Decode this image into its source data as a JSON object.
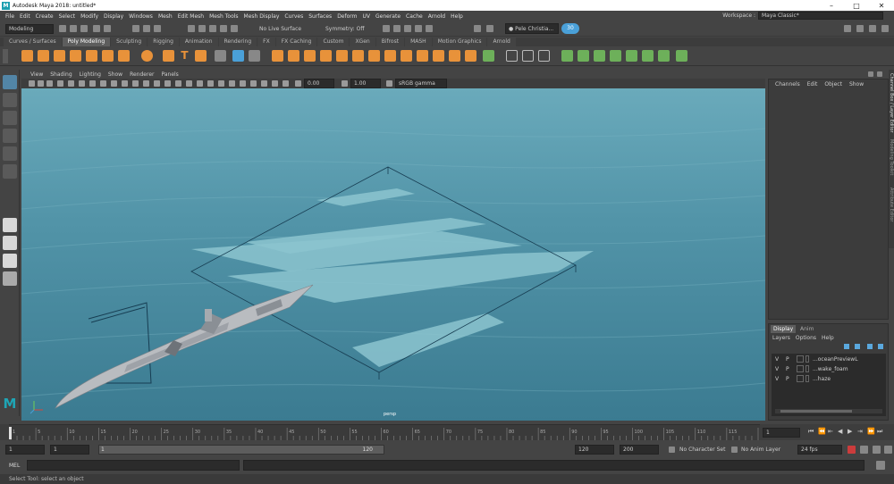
{
  "window": {
    "title": "Autodesk Maya 2018: untitled*",
    "app_icon_letter": "M",
    "controls": [
      "minimize-icon",
      "maximize-icon",
      "close-icon"
    ]
  },
  "menubar": {
    "items": [
      "File",
      "Edit",
      "Create",
      "Select",
      "Modify",
      "Display",
      "Windows",
      "Mesh",
      "Edit Mesh",
      "Mesh Tools",
      "Mesh Display",
      "Curves",
      "Surfaces",
      "Deform",
      "UV",
      "Generate",
      "Cache",
      "Arnold",
      "Help"
    ],
    "workspace_label": "Workspace :",
    "workspace_value": "Maya Classic*"
  },
  "statusline": {
    "menuset": "Modeling",
    "live_surface": "No Live Surface",
    "symmetry": "Symmetry: Off",
    "user": "Pele Christia...",
    "notification_count": "30"
  },
  "shelf": {
    "tabs": [
      "Curves / Surfaces",
      "Poly Modeling",
      "Sculpting",
      "Rigging",
      "Animation",
      "Rendering",
      "FX",
      "FX Caching",
      "Custom",
      "XGen",
      "Bifrost",
      "MASH",
      "Motion Graphics",
      "Arnold"
    ],
    "active_tab": 1
  },
  "panel": {
    "menu": [
      "View",
      "Shading",
      "Lighting",
      "Show",
      "Renderer",
      "Panels"
    ],
    "exposure": "0.00",
    "gamma": "1.00",
    "color_space": "sRGB gamma",
    "camera_label": "persp"
  },
  "channel_box": {
    "menu": [
      "Channels",
      "Edit",
      "Object",
      "Show"
    ]
  },
  "side_tabs": [
    "Channel Box / Layer Editor",
    "Modeling Toolkit",
    "Attribute Editor"
  ],
  "layer_editor": {
    "tabs": [
      "Display",
      "Anim"
    ],
    "menu": [
      "Layers",
      "Options",
      "Help"
    ],
    "layers": [
      {
        "v": "V",
        "p": "P",
        "name": "...oceanPreviewL"
      },
      {
        "v": "V",
        "p": "P",
        "name": "...wake_foam"
      },
      {
        "v": "V",
        "p": "P",
        "name": "...haze"
      }
    ]
  },
  "timeslider": {
    "ticks": [
      "1",
      "5",
      "10",
      "15",
      "20",
      "25",
      "30",
      "35",
      "40",
      "45",
      "50",
      "55",
      "60",
      "65",
      "70",
      "75",
      "80",
      "85",
      "90",
      "95",
      "100",
      "105",
      "110",
      "115",
      "120"
    ],
    "current_frame": "1"
  },
  "range": {
    "start": "1",
    "playback_start": "1",
    "slider_start": "1",
    "slider_end": "120",
    "playback_end": "120",
    "end": "200",
    "character_set": "No Character Set",
    "anim_layer": "No Anim Layer",
    "fps": "24 fps"
  },
  "command": {
    "label": "MEL"
  },
  "helpline": "Select Tool: select an object",
  "colors": {
    "ocean_top": "#63a5b6",
    "ocean_bottom": "#3f7f94",
    "shelf_orange": "#e8923a",
    "shelf_green": "#6db05a",
    "accent_blue": "#4aa0d8"
  }
}
